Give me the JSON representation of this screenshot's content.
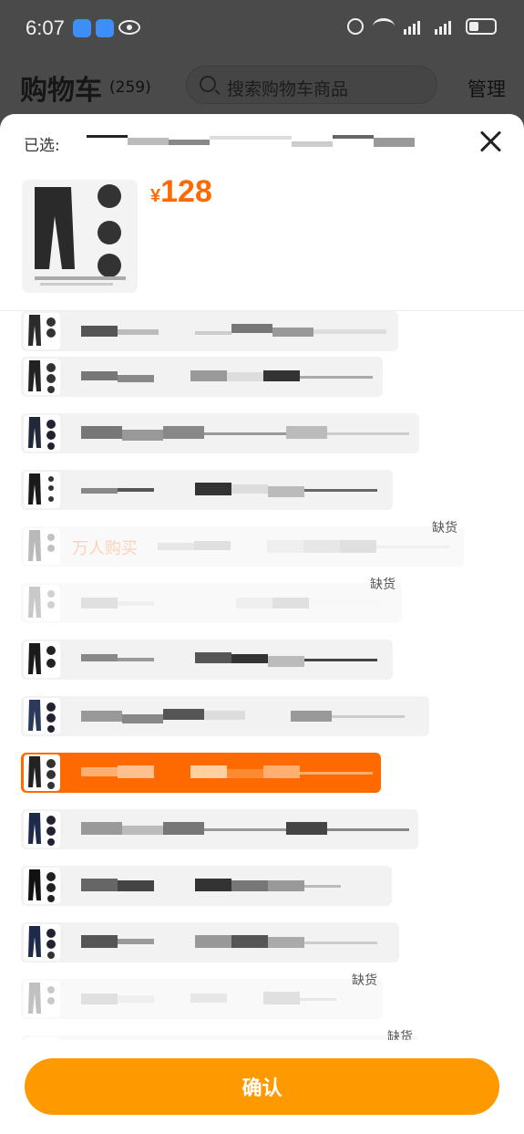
{
  "status_bar": {
    "time": "6:07"
  },
  "header": {
    "title": "购物车",
    "count": "(259)",
    "search_placeholder": "搜索购物车商品",
    "manage": "管理"
  },
  "sheet": {
    "selected_label": "已选:",
    "price_symbol": "¥",
    "price": "128"
  },
  "sku_list": [
    {
      "promo": "",
      "stock_note": "",
      "selected": false,
      "out_of_stock": false
    },
    {
      "promo": "",
      "stock_note": "",
      "selected": false,
      "out_of_stock": false
    },
    {
      "promo": "",
      "stock_note": "",
      "selected": false,
      "out_of_stock": false
    },
    {
      "promo": "",
      "stock_note": "",
      "selected": false,
      "out_of_stock": false
    },
    {
      "promo": "万人购买",
      "stock_note": "缺货",
      "selected": false,
      "out_of_stock": true
    },
    {
      "promo": "",
      "stock_note": "缺货",
      "selected": false,
      "out_of_stock": true
    },
    {
      "promo": "",
      "stock_note": "",
      "selected": false,
      "out_of_stock": false
    },
    {
      "promo": "",
      "stock_note": "",
      "selected": false,
      "out_of_stock": false
    },
    {
      "promo": "",
      "stock_note": "",
      "selected": true,
      "out_of_stock": false
    },
    {
      "promo": "",
      "stock_note": "",
      "selected": false,
      "out_of_stock": false
    },
    {
      "promo": "",
      "stock_note": "",
      "selected": false,
      "out_of_stock": false
    },
    {
      "promo": "",
      "stock_note": "",
      "selected": false,
      "out_of_stock": false
    },
    {
      "promo": "",
      "stock_note": "缺货",
      "selected": false,
      "out_of_stock": true
    },
    {
      "promo": "",
      "stock_note": "缺货",
      "selected": false,
      "out_of_stock": true
    }
  ],
  "footer": {
    "confirm": "确认"
  },
  "colors": {
    "accent": "#ff6a00",
    "confirm": "#ff9900",
    "overlay": "#4a4a4a"
  }
}
